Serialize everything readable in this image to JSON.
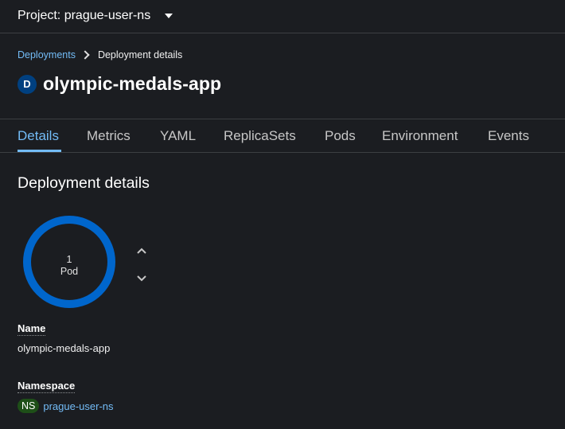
{
  "project_bar": {
    "label": "Project: prague-user-ns"
  },
  "breadcrumb": {
    "parent": "Deployments",
    "current": "Deployment details"
  },
  "header": {
    "kind_badge": "D",
    "title": "olympic-medals-app"
  },
  "tabs": [
    {
      "label": "Details",
      "active": true
    },
    {
      "label": "Metrics"
    },
    {
      "label": "YAML"
    },
    {
      "label": "ReplicaSets"
    },
    {
      "label": "Pods"
    },
    {
      "label": "Environment"
    },
    {
      "label": "Events"
    }
  ],
  "details": {
    "section_title": "Deployment details",
    "pod_count": "1",
    "pod_label": "Pod",
    "name_label": "Name",
    "name_value": "olympic-medals-app",
    "namespace_label": "Namespace",
    "namespace_badge": "NS",
    "namespace_value": "prague-user-ns"
  },
  "colors": {
    "background": "#1b1d21",
    "accent_link": "#73bcf7",
    "donut_ring": "#0066cc",
    "kind_badge_bg": "#004080",
    "ns_badge_bg": "#1e4f18"
  },
  "icons": {
    "project_dropdown": "caret-down-icon",
    "breadcrumb_separator": "chevron-right-icon",
    "scale_up": "chevron-up-icon",
    "scale_down": "chevron-down-icon"
  }
}
